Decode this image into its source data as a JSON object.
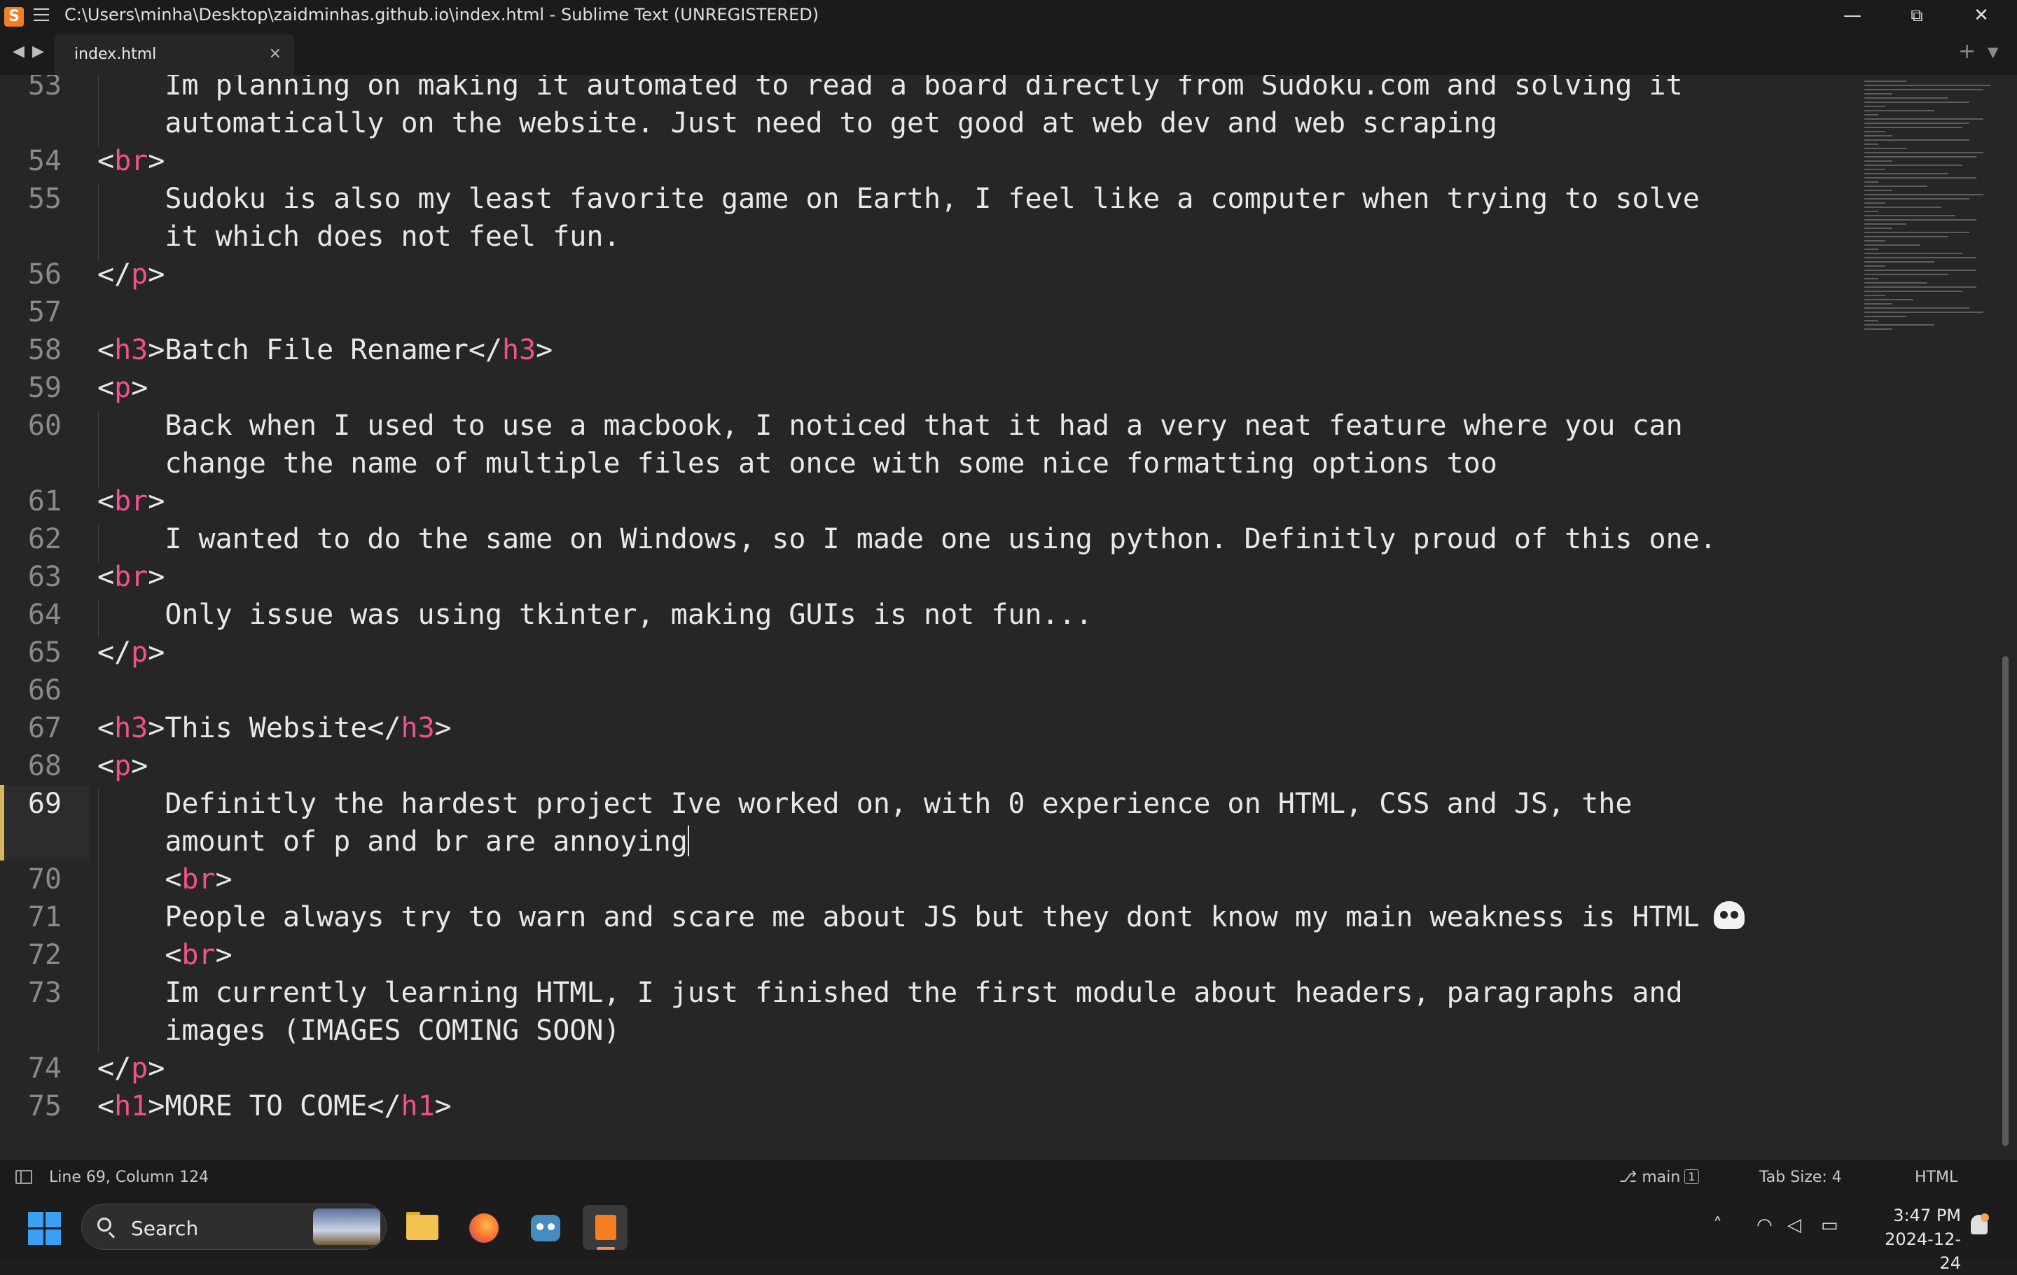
{
  "window": {
    "title": "C:\\Users\\minha\\Desktop\\zaidminhas.github.io\\index.html - Sublime Text (UNREGISTERED)",
    "minimize": "—",
    "restore": "⧉",
    "close": "✕"
  },
  "tabs": [
    {
      "label": "index.html",
      "close": "×"
    }
  ],
  "tabbar": {
    "back": "◀",
    "forward": "▶",
    "new_tab": "+",
    "tab_list": "▼"
  },
  "editor": {
    "active_line": "69",
    "lines": [
      {
        "num": "53",
        "text": "    Im planning on making it automated to read a board directly from Sudoku.com and solving it"
      },
      {
        "num": "",
        "text": "    automatically on the website. Just need to get good at web dev and web scraping"
      },
      {
        "num": "54",
        "text": "<br>"
      },
      {
        "num": "55",
        "text": "    Sudoku is also my least favorite game on Earth, I feel like a computer when trying to solve"
      },
      {
        "num": "",
        "text": "    it which does not feel fun."
      },
      {
        "num": "56",
        "text": "</p>"
      },
      {
        "num": "57",
        "text": ""
      },
      {
        "num": "58",
        "text": "<h3>Batch File Renamer</h3>"
      },
      {
        "num": "59",
        "text": "<p>"
      },
      {
        "num": "60",
        "text": "    Back when I used to use a macbook, I noticed that it had a very neat feature where you can"
      },
      {
        "num": "",
        "text": "    change the name of multiple files at once with some nice formatting options too"
      },
      {
        "num": "61",
        "text": "<br>"
      },
      {
        "num": "62",
        "text": "    I wanted to do the same on Windows, so I made one using python. Definitly proud of this one."
      },
      {
        "num": "63",
        "text": "<br>"
      },
      {
        "num": "64",
        "text": "    Only issue was using tkinter, making GUIs is not fun..."
      },
      {
        "num": "65",
        "text": "</p>"
      },
      {
        "num": "66",
        "text": ""
      },
      {
        "num": "67",
        "text": "<h3>This Website</h3>"
      },
      {
        "num": "68",
        "text": "<p>"
      },
      {
        "num": "69",
        "text": "    Definitly the hardest project Ive worked on, with 0 experience on HTML, CSS and JS, the"
      },
      {
        "num": "",
        "text": "    amount of p and br are annoying"
      },
      {
        "num": "70",
        "text": "    <br>"
      },
      {
        "num": "71",
        "text": "    People always try to warn and scare me about JS but they dont know my main weakness is HTML"
      },
      {
        "num": "72",
        "text": "    <br>"
      },
      {
        "num": "73",
        "text": "    Im currently learning HTML, I just finished the first module about headers, paragraphs and"
      },
      {
        "num": "",
        "text": "    images (IMAGES COMING SOON)"
      },
      {
        "num": "74",
        "text": "</p>"
      },
      {
        "num": "75",
        "text": "<h1>MORE TO COME</h1>"
      }
    ]
  },
  "statusbar": {
    "position": "Line 69, Column 124",
    "branch": "main",
    "branch_count": "1",
    "tab_size": "Tab Size: 4",
    "syntax": "HTML"
  },
  "taskbar": {
    "search_placeholder": "Search",
    "time": "3:47 PM",
    "date": "2024-12-24",
    "apps": [
      "file-explorer",
      "firefox",
      "godot",
      "sublime-text"
    ]
  },
  "colors": {
    "tag": "#f0518f",
    "text": "#e8e8e8",
    "line_number": "#8a8a8a",
    "background": "#262626",
    "accent": "#d9b65e"
  }
}
